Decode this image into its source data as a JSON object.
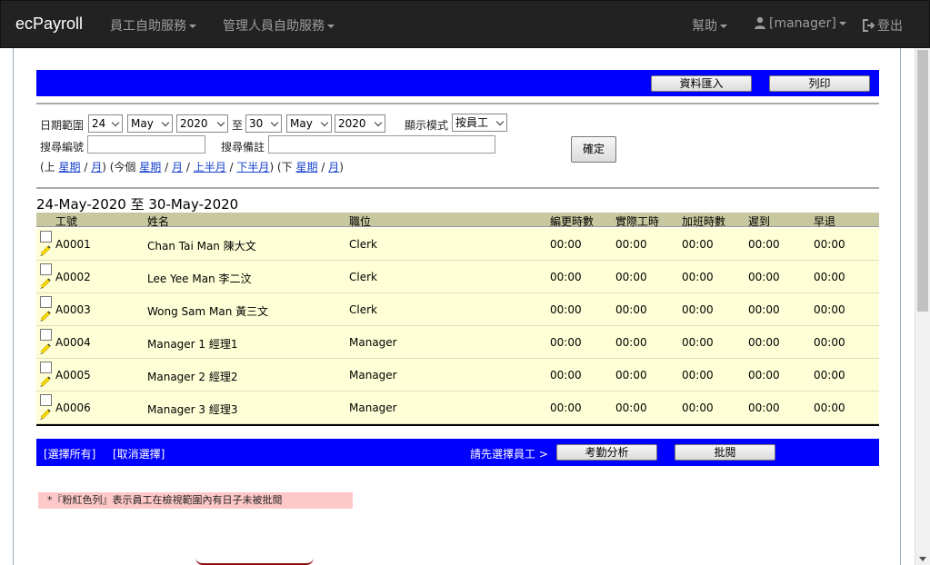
{
  "nav": {
    "brand": "ecPayroll",
    "employee_services": "員工自助服務",
    "manager_services": "管理人員自助服務",
    "help": "幫助",
    "user": "[manager]",
    "logout": "登出"
  },
  "toolbar": {
    "import_label": "資料匯入",
    "print_label": "列印"
  },
  "filter": {
    "date_range_label": "日期範圍",
    "from_day": "24",
    "from_month": "May",
    "from_year": "2020",
    "to_label": "至",
    "to_day": "30",
    "to_month": "May",
    "to_year": "2020",
    "display_mode_label": "顯示模式",
    "display_mode": "按員工",
    "search_id_label": "搜尋編號",
    "search_id_value": "",
    "search_remark_label": "搜尋備註",
    "search_remark_value": "",
    "confirm_label": "確定",
    "quick": {
      "prev_open": "(上",
      "prev_week": "星期",
      "sep1": "/",
      "prev_month": "月",
      "this_open": ") (今個",
      "this_week": "星期",
      "sep2": "/",
      "this_month": "月",
      "sep3": "/",
      "first_half": "上半月",
      "sep4": "/",
      "second_half": "下半月",
      "next_open": ") (下",
      "next_week": "星期",
      "sep5": "/",
      "next_month": "月",
      "close": ")"
    }
  },
  "report": {
    "date_range_title": "24-May-2020 至 30-May-2020",
    "columns": [
      "工號",
      "姓名",
      "職位",
      "編更時數",
      "實際工時",
      "加班時數",
      "遲到",
      "早退"
    ],
    "rows": [
      [
        "A0001",
        "Chan Tai Man 陳大文",
        "Clerk",
        "00:00",
        "00:00",
        "00:00",
        "00:00",
        "00:00"
      ],
      [
        "A0002",
        "Lee Yee Man 李二汶",
        "Clerk",
        "00:00",
        "00:00",
        "00:00",
        "00:00",
        "00:00"
      ],
      [
        "A0003",
        "Wong Sam Man 黃三文",
        "Clerk",
        "00:00",
        "00:00",
        "00:00",
        "00:00",
        "00:00"
      ],
      [
        "A0004",
        "Manager 1 經理1",
        "Manager",
        "00:00",
        "00:00",
        "00:00",
        "00:00",
        "00:00"
      ],
      [
        "A0005",
        "Manager 2 經理2",
        "Manager",
        "00:00",
        "00:00",
        "00:00",
        "00:00",
        "00:00"
      ],
      [
        "A0006",
        "Manager 3 經理3",
        "Manager",
        "00:00",
        "00:00",
        "00:00",
        "00:00",
        "00:00"
      ]
    ]
  },
  "footer": {
    "select_all": "[選擇所有]",
    "deselect": "[取消選擇]",
    "prompt": "請先選擇員工 >",
    "attendance_analysis": "考勤分析",
    "approve": "批閱"
  },
  "note": "*『粉紅色列』表示員工在檢視範圍內有日子未被批閱",
  "colors": {
    "navbar": "#222222",
    "toolbar_blue": "#0000ff",
    "table_header": "#c8c8a0",
    "row_bg": "#ffffd7",
    "note_bg": "#ffc8c8",
    "link": "#1a44cc"
  }
}
